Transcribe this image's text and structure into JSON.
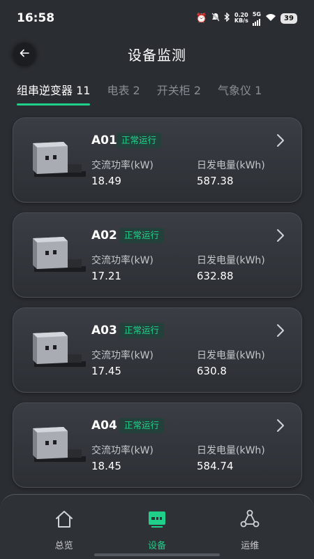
{
  "status_bar": {
    "time": "16:58",
    "net_speed_value": "0.20",
    "net_speed_unit": "KB/s",
    "network": "5G",
    "battery": "39"
  },
  "header": {
    "title": "设备监测"
  },
  "tabs": [
    {
      "label": "组串逆变器 11",
      "active": true
    },
    {
      "label": "电表 2",
      "active": false
    },
    {
      "label": "开关柜 2",
      "active": false
    },
    {
      "label": "气象仪 1",
      "active": false
    }
  ],
  "devices": [
    {
      "name": "A01",
      "status": "正常运行",
      "power_label": "交流功率(kW)",
      "power_value": "18.49",
      "energy_label": "日发电量(kWh)",
      "energy_value": "587.38"
    },
    {
      "name": "A02",
      "status": "正常运行",
      "power_label": "交流功率(kW)",
      "power_value": "17.21",
      "energy_label": "日发电量(kWh)",
      "energy_value": "632.88"
    },
    {
      "name": "A03",
      "status": "正常运行",
      "power_label": "交流功率(kW)",
      "power_value": "17.45",
      "energy_label": "日发电量(kWh)",
      "energy_value": "630.8"
    },
    {
      "name": "A04",
      "status": "正常运行",
      "power_label": "交流功率(kW)",
      "power_value": "18.45",
      "energy_label": "日发电量(kWh)",
      "energy_value": "584.74"
    }
  ],
  "bottom_nav": [
    {
      "label": "总览",
      "icon": "home-icon",
      "active": false
    },
    {
      "label": "设备",
      "icon": "device-icon",
      "active": true
    },
    {
      "label": "运维",
      "icon": "network-icon",
      "active": false
    }
  ],
  "colors": {
    "accent": "#1fcf8a",
    "background": "#2a2d32",
    "card": "#35383e",
    "status_badge_bg": "#24403a"
  }
}
